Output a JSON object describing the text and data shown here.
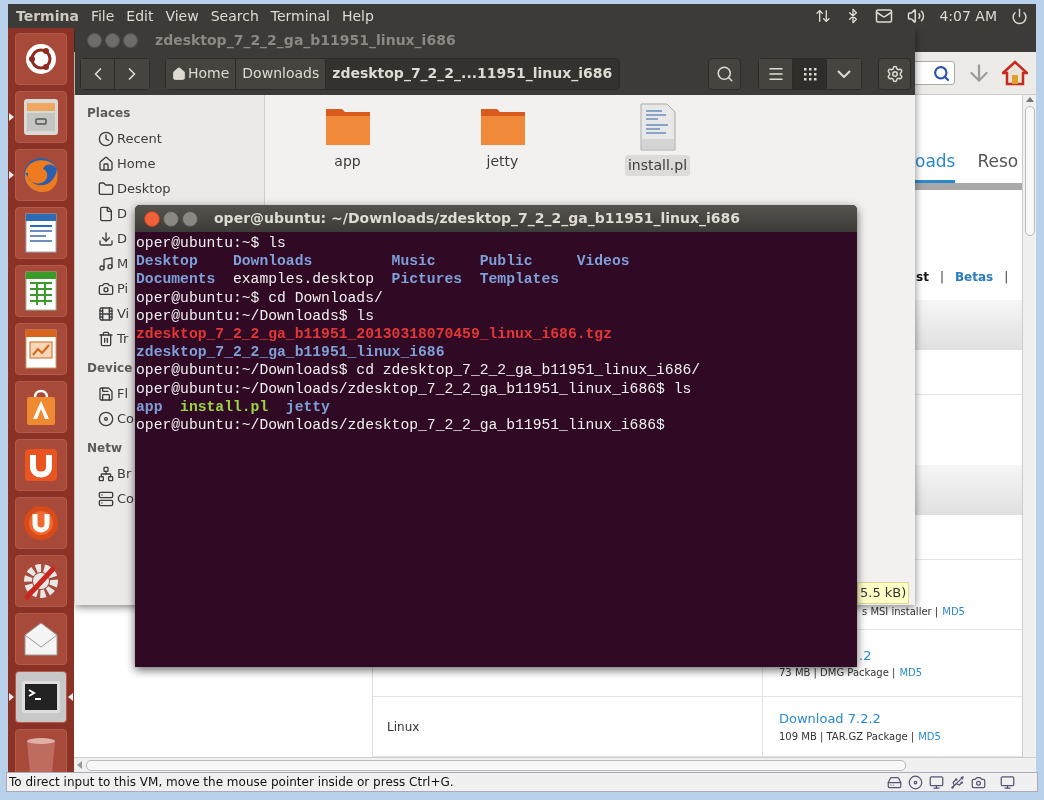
{
  "top_panel": {
    "app_name": "Termina",
    "menus": [
      "File",
      "Edit",
      "View",
      "Search",
      "Terminal",
      "Help"
    ],
    "clock": "4:07 AM"
  },
  "launcher": [
    {
      "kind": "dash",
      "running": false,
      "focused": false
    },
    {
      "kind": "files",
      "running": true,
      "focused": false
    },
    {
      "kind": "browser",
      "running": true,
      "focused": false
    },
    {
      "kind": "writer",
      "running": false,
      "focused": false
    },
    {
      "kind": "calc",
      "running": false,
      "focused": false
    },
    {
      "kind": "impress",
      "running": false,
      "focused": false
    },
    {
      "kind": "software",
      "running": false,
      "focused": false
    },
    {
      "kind": "cloud",
      "running": false,
      "focused": false
    },
    {
      "kind": "music",
      "running": false,
      "focused": false
    },
    {
      "kind": "settings",
      "running": false,
      "focused": false
    },
    {
      "kind": "mail",
      "running": false,
      "focused": false
    },
    {
      "kind": "terminal",
      "running": true,
      "focused": true
    },
    {
      "kind": "trash",
      "running": false,
      "focused": false
    }
  ],
  "browser": {
    "tabs": [
      {
        "label": "oads",
        "selected": true
      },
      {
        "label": "Reso",
        "selected": false
      }
    ],
    "links": [
      {
        "text": "st",
        "kind": "current"
      },
      {
        "text": "|",
        "kind": "separator"
      },
      {
        "text": "Betas",
        "kind": "link"
      },
      {
        "text": "|",
        "kind": "separator"
      }
    ],
    "tooltip": "5.5 kB)",
    "rows": [
      {
        "kind": "msi",
        "size_line": "s MSI installer |",
        "md5": "MD5"
      },
      {
        "kind": "dmg",
        "download": ".2",
        "size_line": "73 MB | DMG Package |",
        "md5": "MD5"
      },
      {
        "kind": "linux",
        "platform": "Linux",
        "download": "Download 7.2.2",
        "size_line": "109 MB | TAR.GZ Package |",
        "md5": "MD5"
      }
    ]
  },
  "file_manager": {
    "title": "zdesktop_7_2_2_ga_b11951_linux_i686",
    "breadcrumbs": [
      {
        "kind": "home",
        "label": "Home",
        "selected": false
      },
      {
        "kind": "folder",
        "label": "Downloads",
        "selected": false
      },
      {
        "kind": "folder",
        "label": "zdesktop_7_2_2_...11951_linux_i686",
        "selected": true
      }
    ],
    "views": [
      {
        "kind": "list",
        "selected": false
      },
      {
        "kind": "grid",
        "selected": true
      }
    ],
    "sidebar": [
      {
        "kind": "header",
        "label": "Places"
      },
      {
        "kind": "recent",
        "label": "Recent"
      },
      {
        "kind": "home",
        "label": "Home"
      },
      {
        "kind": "folder",
        "label": "Desktop"
      },
      {
        "kind": "file",
        "label": "D"
      },
      {
        "kind": "download",
        "label": "D"
      },
      {
        "kind": "music",
        "label": "M"
      },
      {
        "kind": "camera",
        "label": "Pi"
      },
      {
        "kind": "film",
        "label": "Vi"
      },
      {
        "kind": "trash",
        "label": "Tr"
      },
      {
        "kind": "header",
        "label": "Device"
      },
      {
        "kind": "floppy",
        "label": "Fl"
      },
      {
        "kind": "disc",
        "label": "Co"
      },
      {
        "kind": "header",
        "label": "Netw"
      },
      {
        "kind": "network",
        "label": "Br"
      },
      {
        "kind": "server",
        "label": "Co"
      }
    ],
    "files": [
      {
        "kind": "folder",
        "name": "app",
        "selected": false
      },
      {
        "kind": "folder",
        "name": "jetty",
        "selected": false
      },
      {
        "kind": "script",
        "name": "install.pl",
        "selected": true
      }
    ]
  },
  "terminal": {
    "title": "oper@ubuntu: ~/Downloads/zdesktop_7_2_2_ga_b11951_linux_i686",
    "lines": [
      {
        "kind": "prompt",
        "text": "oper@ubuntu:~$ ls"
      },
      {
        "kind": "listing",
        "rows": [
          [
            {
              "text": "Desktop",
              "kind": "dir"
            },
            {
              "text": "Downloads",
              "kind": "dir"
            },
            {
              "text": "Music",
              "kind": "dir"
            },
            {
              "text": "Public",
              "kind": "dir"
            },
            {
              "text": "Videos",
              "kind": "dir"
            }
          ],
          [
            {
              "text": "Documents",
              "kind": "dir"
            },
            {
              "text": "examples.desktop",
              "kind": "plain"
            },
            {
              "text": "Pictures",
              "kind": "dir"
            },
            {
              "text": "Templates",
              "kind": "dir"
            }
          ]
        ]
      },
      {
        "kind": "prompt",
        "text": "oper@ubuntu:~$ cd Downloads/"
      },
      {
        "kind": "prompt",
        "text": "oper@ubuntu:~/Downloads$ ls"
      },
      {
        "kind": "listing",
        "rows": [
          [
            {
              "text": "zdesktop_7_2_2_ga_b11951_20130318070459_linux_i686.tgz",
              "kind": "archive"
            }
          ]
        ]
      },
      {
        "kind": "listing",
        "rows": [
          [
            {
              "text": "zdesktop_7_2_2_ga_b11951_linux_i686",
              "kind": "dir"
            }
          ]
        ]
      },
      {
        "kind": "prompt",
        "text": "oper@ubuntu:~/Downloads$ cd zdesktop_7_2_2_ga_b11951_linux_i686/"
      },
      {
        "kind": "prompt",
        "text": "oper@ubuntu:~/Downloads/zdesktop_7_2_2_ga_b11951_linux_i686$ ls"
      },
      {
        "kind": "listing",
        "rows": [
          [
            {
              "text": "app",
              "kind": "dir"
            },
            {
              "text": "install.pl",
              "kind": "exec"
            },
            {
              "text": "jetty",
              "kind": "dir"
            }
          ]
        ]
      },
      {
        "kind": "prompt",
        "text": "oper@ubuntu:~/Downloads/zdesktop_7_2_2_ga_b11951_linux_i686$"
      }
    ]
  },
  "status_bar": {
    "text": "To direct input to this VM, move the mouse pointer inside or press Ctrl+G."
  }
}
